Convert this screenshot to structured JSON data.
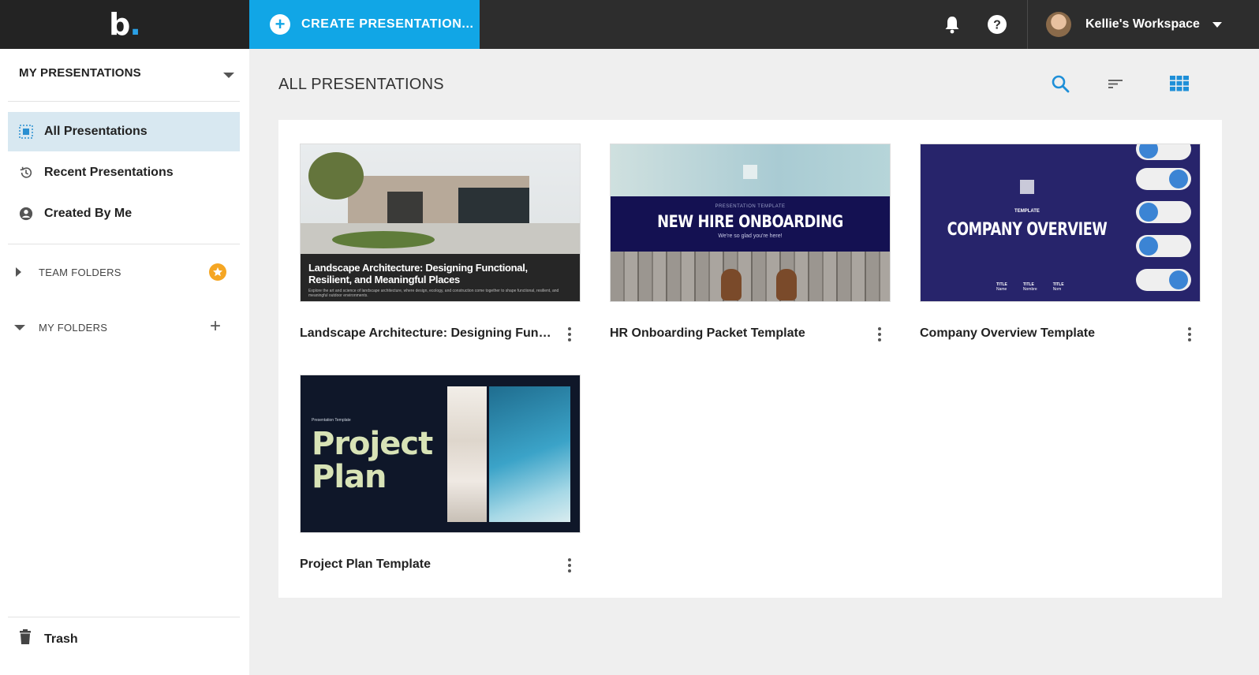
{
  "app": {
    "logo_text": "b",
    "create_button_label": "CREATE PRESENTATION...",
    "workspace_name": "Kellie's Workspace",
    "accent_color": "#11a6e6"
  },
  "sidebar": {
    "header": "MY PRESENTATIONS",
    "nav": [
      {
        "label": "All Presentations",
        "icon": "grid-select-icon",
        "active": true
      },
      {
        "label": "Recent Presentations",
        "icon": "history-icon",
        "active": false
      },
      {
        "label": "Created By Me",
        "icon": "user-circle-icon",
        "active": false
      }
    ],
    "team_folders_label": "TEAM FOLDERS",
    "my_folders_label": "MY FOLDERS",
    "trash_label": "Trash"
  },
  "main": {
    "title": "ALL PRESENTATIONS",
    "presentations": [
      {
        "title": "Landscape Architecture: Designing Functi...",
        "thumb_heading": "Landscape Architecture: Designing Functional, Resilient, and Meaningful Places",
        "thumb_sub": "Explore the art and science of landscape architecture, where design, ecology, and construction come together to shape functional, resilient, and meaningful outdoor environments."
      },
      {
        "title": "HR Onboarding Packet Template",
        "thumb_small": "PRESENTATION TEMPLATE",
        "thumb_heading": "NEW HIRE ONBOARDING",
        "thumb_sub": "We're so glad you're here!"
      },
      {
        "title": "Company Overview Template",
        "thumb_small": "TEMPLATE",
        "thumb_heading": "COMPANY OVERVIEW",
        "thumb_cols": [
          {
            "title": "TITLE",
            "sub": "Name"
          },
          {
            "title": "TITLE",
            "sub": "Nombre"
          },
          {
            "title": "TITLE",
            "sub": "Nom"
          }
        ]
      },
      {
        "title": "Project Plan Template",
        "thumb_small": "Presentation Template",
        "thumb_heading_1": "Project",
        "thumb_heading_2": "Plan"
      }
    ]
  }
}
